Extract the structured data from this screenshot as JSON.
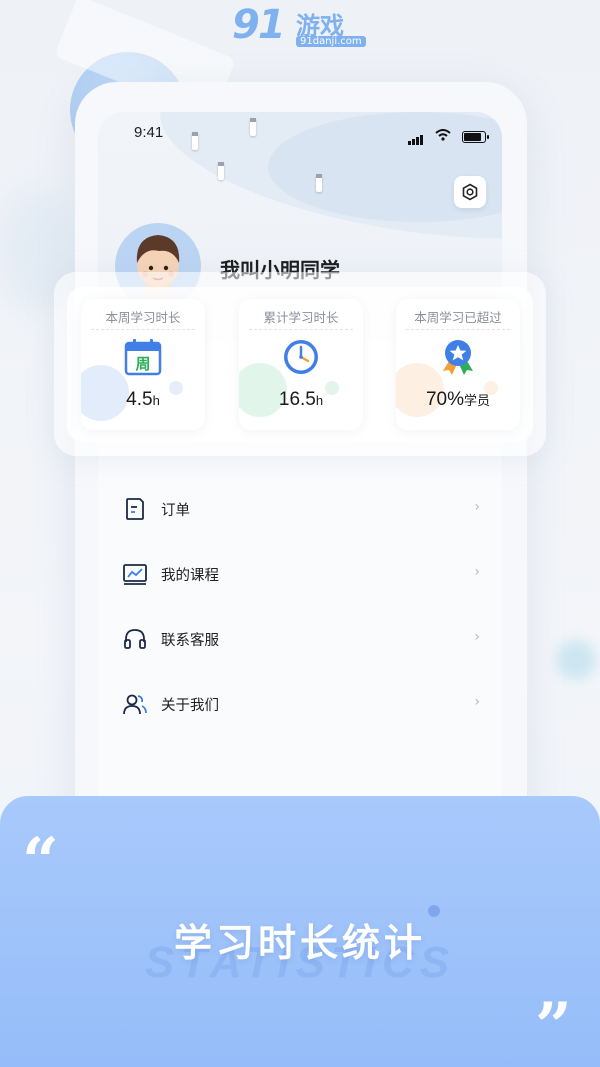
{
  "watermark": {
    "brand": "91",
    "name": "游戏",
    "url": "91danji.com"
  },
  "status_bar": {
    "time": "9:41"
  },
  "profile": {
    "username": "我叫小明同学"
  },
  "stats": [
    {
      "title": "本周学习时长",
      "value": "4.5",
      "unit": "h",
      "icon": "calendar-week-icon"
    },
    {
      "title": "累计学习时长",
      "value": "16.5",
      "unit": "h",
      "icon": "clock-icon"
    },
    {
      "title": "本周学习已超过",
      "value": "70%",
      "unit": "学员",
      "icon": "medal-star-icon"
    }
  ],
  "calendar_glyph": "周",
  "menu": [
    {
      "label": "订单",
      "icon": "order-doc-icon"
    },
    {
      "label": "我的课程",
      "icon": "course-chart-icon"
    },
    {
      "label": "联系客服",
      "icon": "headset-icon"
    },
    {
      "label": "关于我们",
      "icon": "people-icon"
    }
  ],
  "menu_arrow": "›",
  "banner": {
    "title": "学习时长统计",
    "bg_text": "STATISTICS",
    "quote_open": "“",
    "quote_close": "”"
  },
  "colors": {
    "banner": "#96bdf9",
    "accent_blue": "#3f7fe6",
    "calendar_green": "#2fae5a",
    "medal_orange": "#f2a033"
  }
}
